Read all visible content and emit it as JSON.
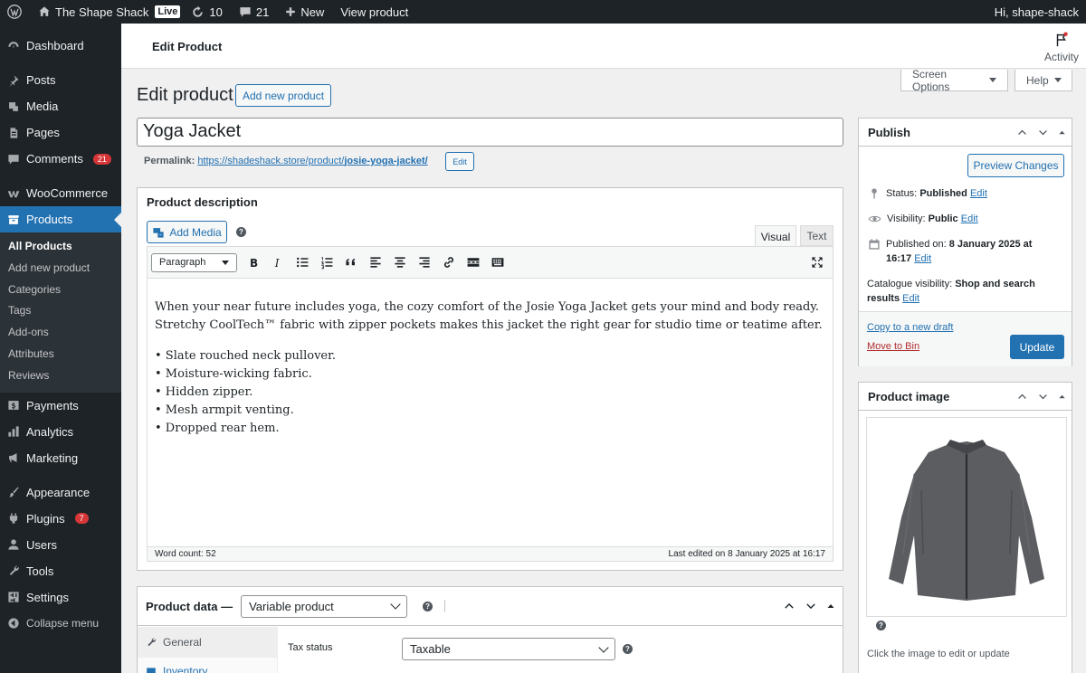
{
  "adminbar": {
    "site_name": "The Shape Shack",
    "live_label": "Live",
    "updates_count": "10",
    "comments_count": "21",
    "new_label": "New",
    "view_label": "View product",
    "greeting": "Hi, shape-shack"
  },
  "sidebar": {
    "dashboard": "Dashboard",
    "posts": "Posts",
    "media": "Media",
    "pages": "Pages",
    "comments": "Comments",
    "comments_badge": "21",
    "woocommerce": "WooCommerce",
    "products": "Products",
    "submenu": [
      "All Products",
      "Add new product",
      "Categories",
      "Tags",
      "Add-ons",
      "Attributes",
      "Reviews"
    ],
    "payments": "Payments",
    "analytics": "Analytics",
    "marketing": "Marketing",
    "appearance": "Appearance",
    "plugins": "Plugins",
    "plugins_badge": "7",
    "users": "Users",
    "tools": "Tools",
    "settings": "Settings",
    "collapse": "Collapse menu"
  },
  "top": {
    "page_title": "Edit Product",
    "activity_label": "Activity",
    "screen_options": "Screen Options",
    "help": "Help"
  },
  "header": {
    "heading": "Edit product",
    "add_new": "Add new product"
  },
  "product": {
    "title": "Yoga Jacket",
    "permalink_label": "Permalink:",
    "permalink_base": "https://shadeshack.store/product/",
    "permalink_slug": "josie-yoga-jacket/",
    "permalink_edit": "Edit"
  },
  "description": {
    "box_title": "Product description",
    "add_media": "Add Media",
    "tab_visual": "Visual",
    "tab_text": "Text",
    "format": "Paragraph",
    "paragraph": "When your near future includes yoga, the cozy comfort of the Josie Yoga Jacket gets your mind and body ready. Stretchy CoolTech™ fabric with zipper pockets makes this jacket the right gear for studio time or teatime after.",
    "bullets": [
      "• Slate rouched neck pullover.",
      "• Moisture-wicking fabric.",
      "• Hidden zipper.",
      "• Mesh armpit venting.",
      "• Dropped rear hem."
    ],
    "word_count": "Word count: 52",
    "last_edited": "Last edited on 8 January 2025 at 16:17"
  },
  "product_data": {
    "label": "Product data —",
    "type": "Variable product",
    "tabs": [
      "General",
      "Inventory"
    ],
    "tax_status_label": "Tax status",
    "tax_status_value": "Taxable"
  },
  "publish": {
    "title": "Publish",
    "preview": "Preview Changes",
    "status_label": "Status:",
    "status_value": "Published",
    "visibility_label": "Visibility:",
    "visibility_value": "Public",
    "published_label": "Published on:",
    "published_value": "8 January 2025 at 16:17",
    "catalogue_label": "Catalogue visibility:",
    "catalogue_value": "Shop and search results",
    "edit": "Edit",
    "copy_draft": "Copy to a new draft",
    "move_bin": "Move to Bin",
    "update": "Update"
  },
  "image": {
    "title": "Product image",
    "hint": "Click the image to edit or update"
  },
  "colors": {
    "accent": "#2271b1",
    "admin_dark": "#1d2327",
    "danger": "#b32d2e",
    "badge": "#d63638"
  }
}
